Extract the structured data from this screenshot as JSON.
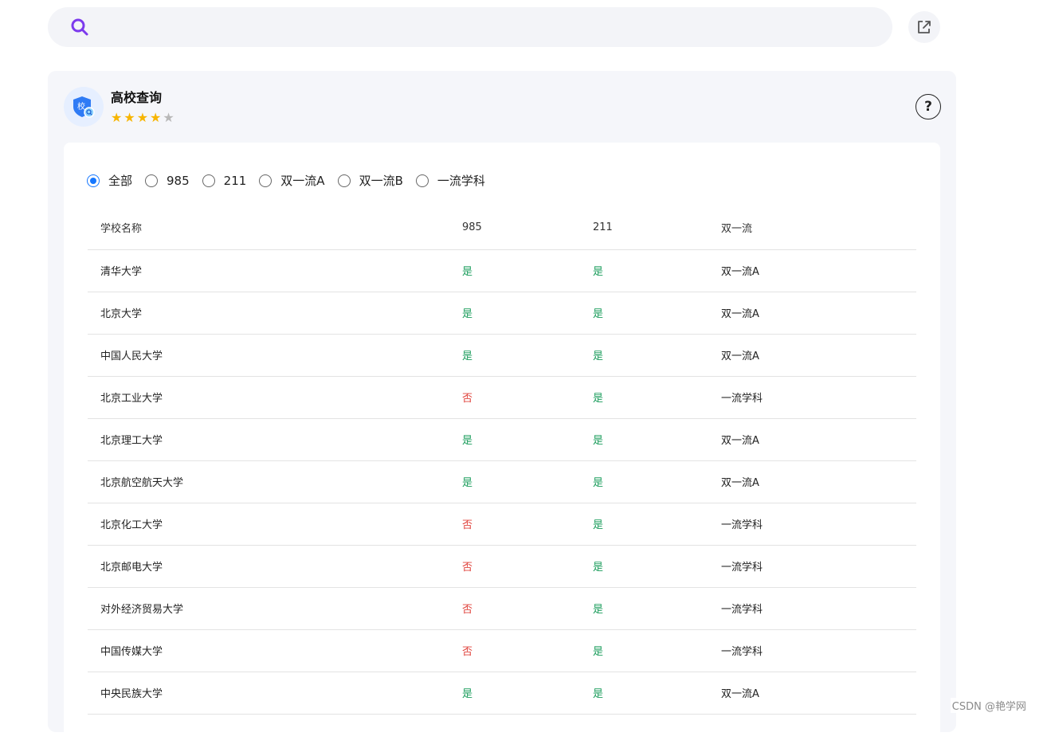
{
  "search": {
    "value": ""
  },
  "app": {
    "title": "高校查询",
    "rating": {
      "value": 4,
      "max": 5
    }
  },
  "filters": [
    {
      "label": "全部",
      "checked": true
    },
    {
      "label": "985",
      "checked": false
    },
    {
      "label": "211",
      "checked": false
    },
    {
      "label": "双一流A",
      "checked": false
    },
    {
      "label": "双一流B",
      "checked": false
    },
    {
      "label": "一流学科",
      "checked": false
    }
  ],
  "table": {
    "headers": [
      "学校名称",
      "985",
      "211",
      "双一流"
    ],
    "rows": [
      [
        "清华大学",
        "是",
        "是",
        "双一流A"
      ],
      [
        "北京大学",
        "是",
        "是",
        "双一流A"
      ],
      [
        "中国人民大学",
        "是",
        "是",
        "双一流A"
      ],
      [
        "北京工业大学",
        "否",
        "是",
        "一流学科"
      ],
      [
        "北京理工大学",
        "是",
        "是",
        "双一流A"
      ],
      [
        "北京航空航天大学",
        "是",
        "是",
        "双一流A"
      ],
      [
        "北京化工大学",
        "否",
        "是",
        "一流学科"
      ],
      [
        "北京邮电大学",
        "否",
        "是",
        "一流学科"
      ],
      [
        "对外经济贸易大学",
        "否",
        "是",
        "一流学科"
      ],
      [
        "中国传媒大学",
        "否",
        "是",
        "一流学科"
      ],
      [
        "中央民族大学",
        "是",
        "是",
        "双一流A"
      ]
    ]
  },
  "colors": {
    "yes": "#1a9c5b",
    "no": "#e0443e",
    "accent": "#1677ff",
    "search_icon": "#7c3aed"
  },
  "watermark": "CSDN @艳学网"
}
